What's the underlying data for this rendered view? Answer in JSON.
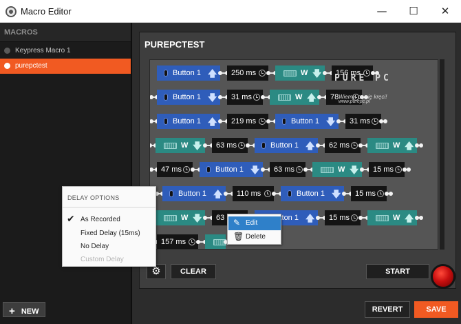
{
  "window": {
    "title": "Macro Editor",
    "minimize": "—",
    "maximize": "☐",
    "close": "✕"
  },
  "sidebar": {
    "header": "MACROS",
    "items": [
      {
        "label": "Keypress Macro 1",
        "selected": false
      },
      {
        "label": "purepctest",
        "selected": true
      }
    ],
    "new_button": "NEW",
    "new_icon": "+"
  },
  "editor": {
    "macro_name": "PUREPCTEST",
    "rows": [
      [
        {
          "type": "mouse",
          "label": "Button 1",
          "dir": "up"
        },
        {
          "type": "delay",
          "label": "250 ms"
        },
        {
          "type": "key",
          "label": "W",
          "dir": "down"
        },
        {
          "type": "delay",
          "label": "156 ms"
        }
      ],
      [
        {
          "type": "mouse",
          "label": "Button 1",
          "dir": "down"
        },
        {
          "type": "delay",
          "label": "31 ms"
        },
        {
          "type": "key",
          "label": "W",
          "dir": "up"
        },
        {
          "type": "delay",
          "label": "78"
        }
      ],
      [
        {
          "type": "mouse",
          "label": "Button 1",
          "dir": "up"
        },
        {
          "type": "delay",
          "label": "219 ms"
        },
        {
          "type": "mouse",
          "label": "Button 1",
          "dir": "down"
        },
        {
          "type": "delay",
          "label": "31 ms"
        }
      ],
      [
        {
          "type": "key",
          "label": "W",
          "dir": "down"
        },
        {
          "type": "delay",
          "label": "63 ms"
        },
        {
          "type": "mouse",
          "label": "Button 1",
          "dir": "up"
        },
        {
          "type": "delay",
          "label": "62 ms"
        },
        {
          "type": "key",
          "label": "W",
          "dir": "up"
        }
      ],
      [
        {
          "type": "delay",
          "label": "47 ms"
        },
        {
          "type": "mouse",
          "label": "Button 1",
          "dir": "down"
        },
        {
          "type": "delay",
          "label": "63 ms"
        },
        {
          "type": "key",
          "label": "W",
          "dir": "down"
        },
        {
          "type": "delay",
          "label": "15 ms"
        }
      ],
      [
        {
          "type": "mouse",
          "label": "Button 1",
          "dir": "up"
        },
        {
          "type": "delay",
          "label": "110 ms"
        },
        {
          "type": "mouse",
          "label": "Button 1",
          "dir": "down"
        },
        {
          "type": "delay",
          "label": "15 ms"
        }
      ],
      [
        {
          "type": "key",
          "label": "W",
          "dir": "down"
        },
        {
          "type": "delay",
          "label": "63 ms"
        },
        {
          "type": "mouse",
          "label": "Button 1",
          "dir": "up"
        },
        {
          "type": "delay",
          "label": "15 ms"
        },
        {
          "type": "key",
          "label": "W",
          "dir": "up"
        }
      ],
      [
        {
          "type": "delay",
          "label": "157 ms"
        },
        {
          "type": "key",
          "label": "",
          "dir": ""
        }
      ]
    ],
    "clear_button": "CLEAR",
    "start_button": "START",
    "gear_icon": "⚙"
  },
  "watermark": {
    "logo": "PURE PC",
    "tagline": "Wiemy, co się kręci!",
    "url": "www.purepc.pl"
  },
  "footer": {
    "revert_button": "REVERT",
    "save_button": "SAVE"
  },
  "delay_options": {
    "header": "DELAY OPTIONS",
    "options": [
      {
        "label": "As Recorded",
        "checked": true,
        "disabled": false
      },
      {
        "label": "Fixed Delay (15ms)",
        "checked": false,
        "disabled": false
      },
      {
        "label": "No Delay",
        "checked": false,
        "disabled": false
      },
      {
        "label": "Custom Delay",
        "checked": false,
        "disabled": true
      }
    ],
    "check_glyph": "✔"
  },
  "context_menu": {
    "items": [
      {
        "label": "Edit",
        "icon": "✎",
        "highlighted": true
      },
      {
        "label": "Delete",
        "icon": "🗑",
        "highlighted": false
      }
    ]
  },
  "colors": {
    "accent": "#f15a22",
    "mouse_chip": "#2f5dba",
    "key_chip": "#2b8a83",
    "delay_chip": "#141414",
    "highlight": "#2f80c9"
  }
}
